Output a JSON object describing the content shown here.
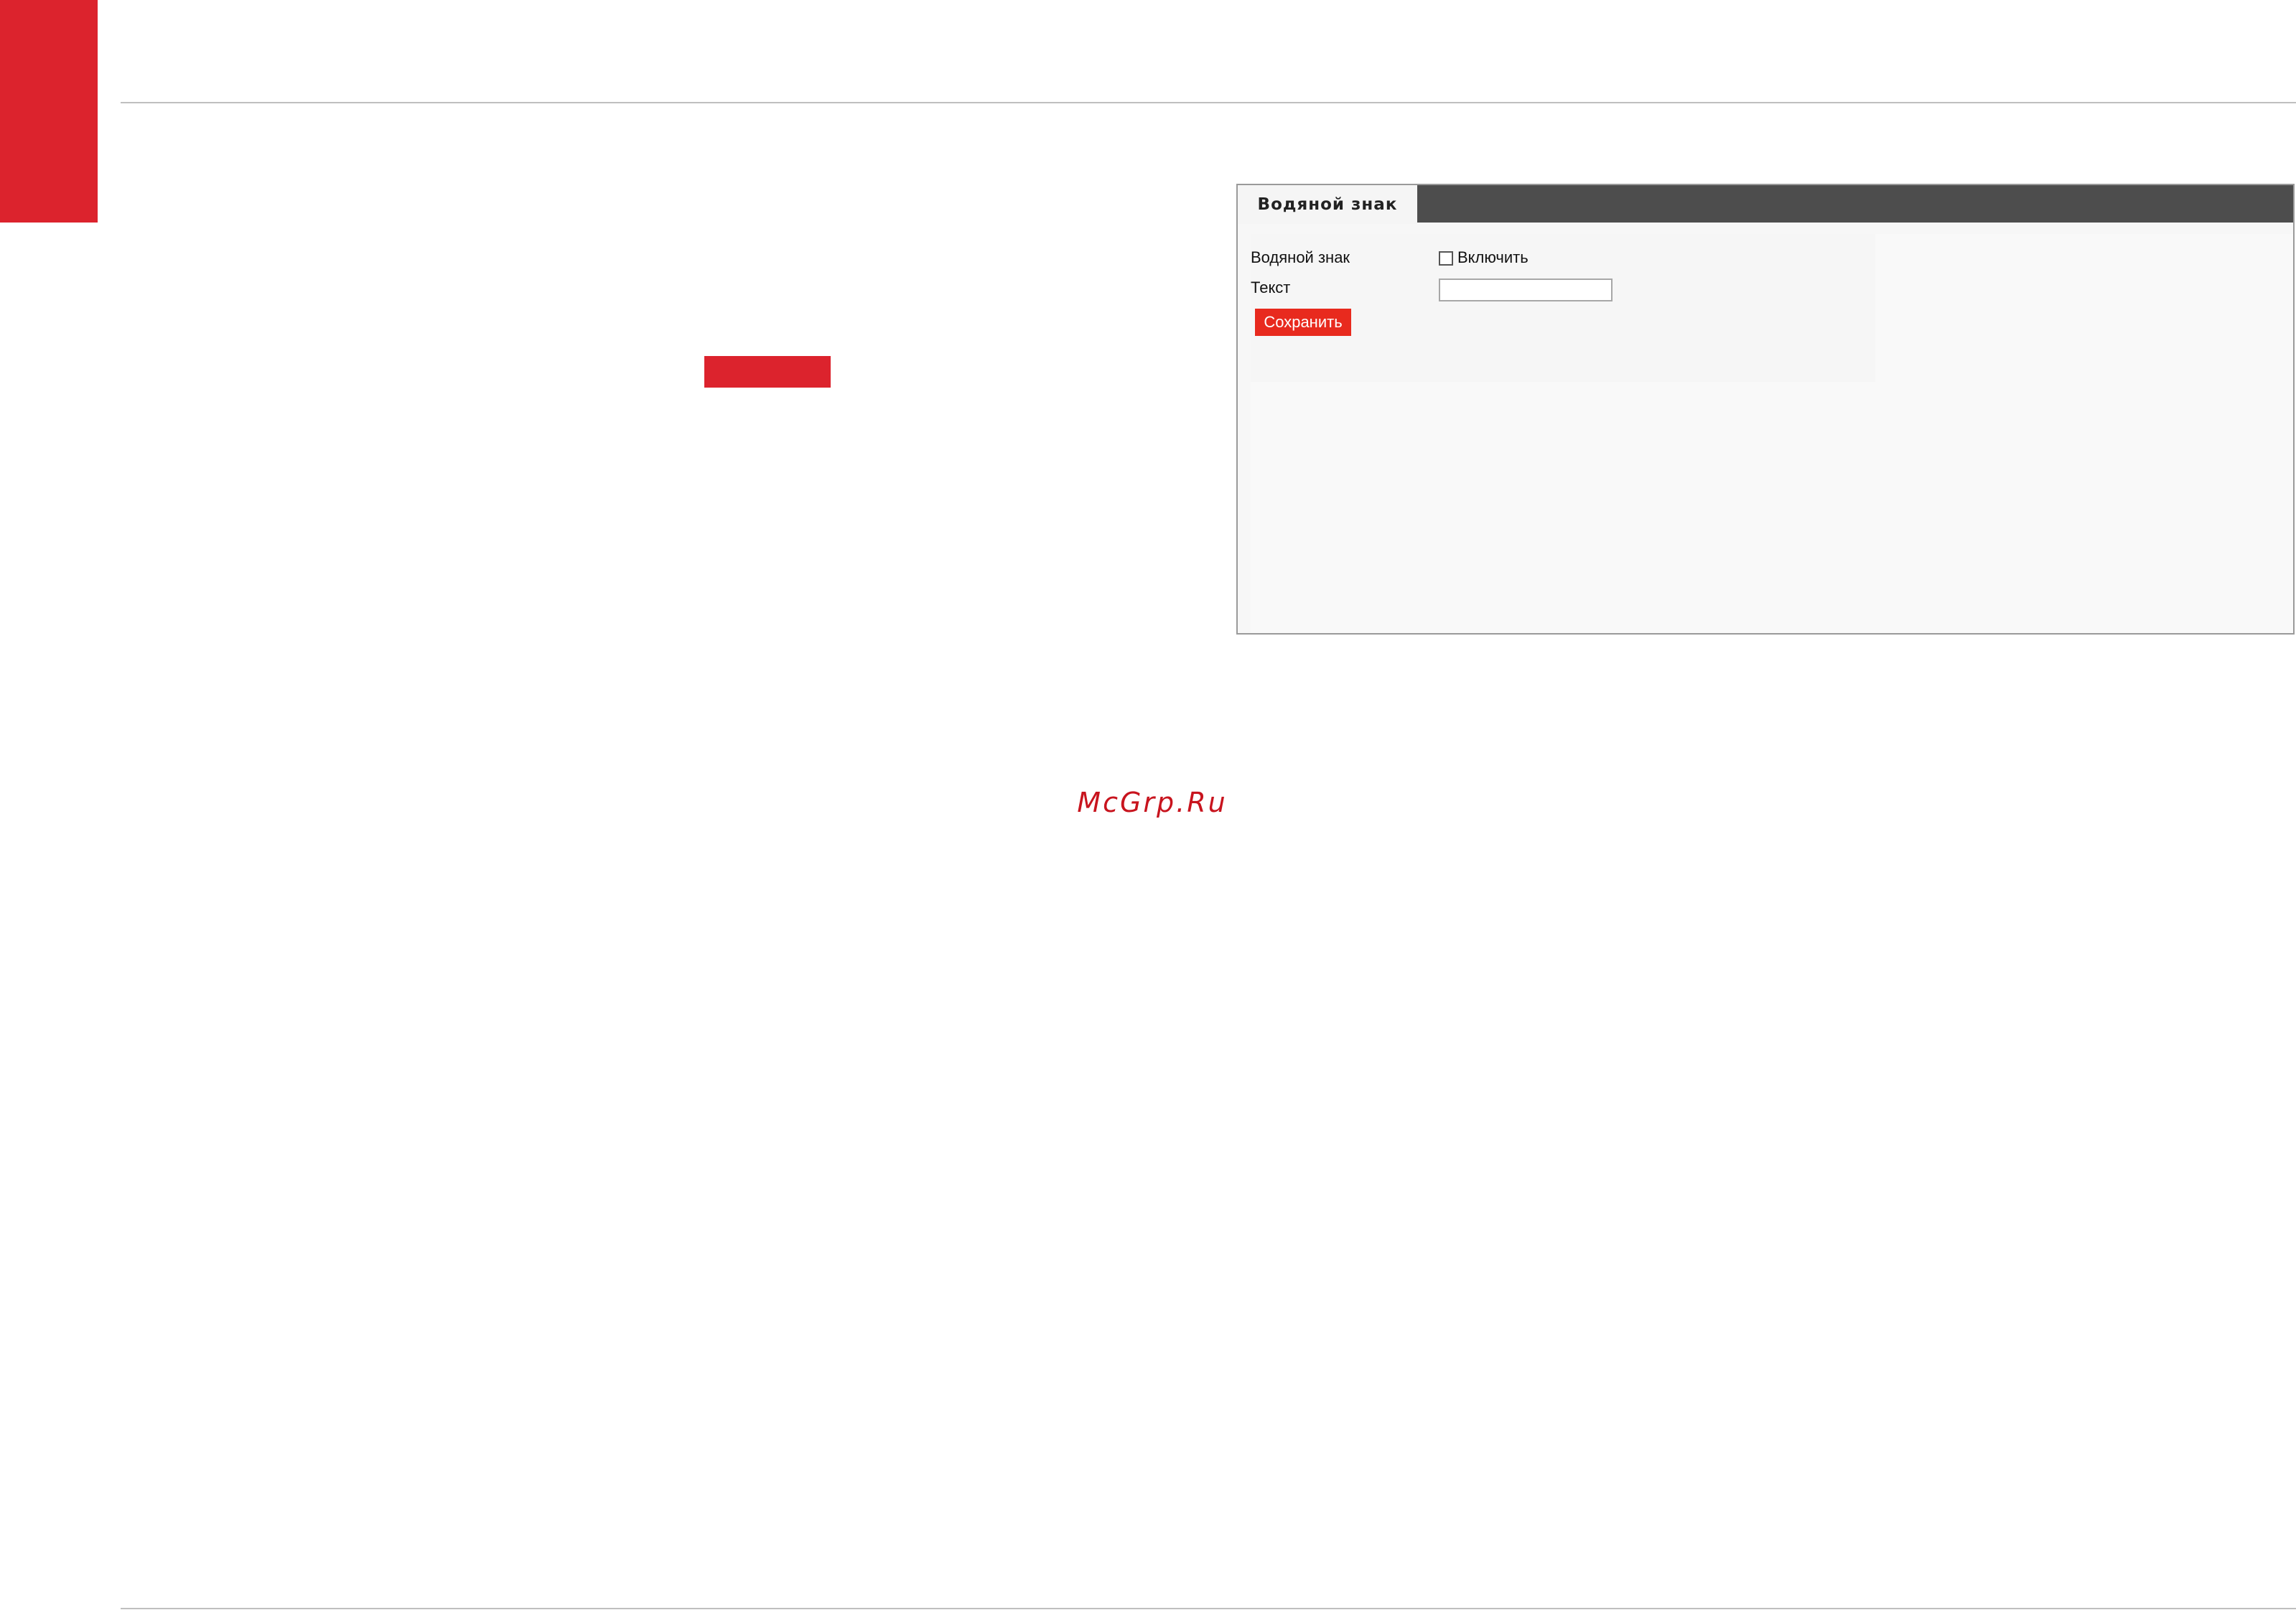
{
  "colors": {
    "accent": "#dc232d",
    "header_dark": "#4d4d4d",
    "save_button": "#e82a1e",
    "watermark": "#c8141e"
  },
  "screenshot": {
    "tab_label": "Водяной знак",
    "form": {
      "watermark_label": "Водяной знак",
      "enable_checkbox_label": "Включить",
      "enable_checked": false,
      "text_label": "Текст",
      "text_value": "",
      "save_label": "Сохранить"
    }
  },
  "watermark_text": "McGrp.Ru"
}
